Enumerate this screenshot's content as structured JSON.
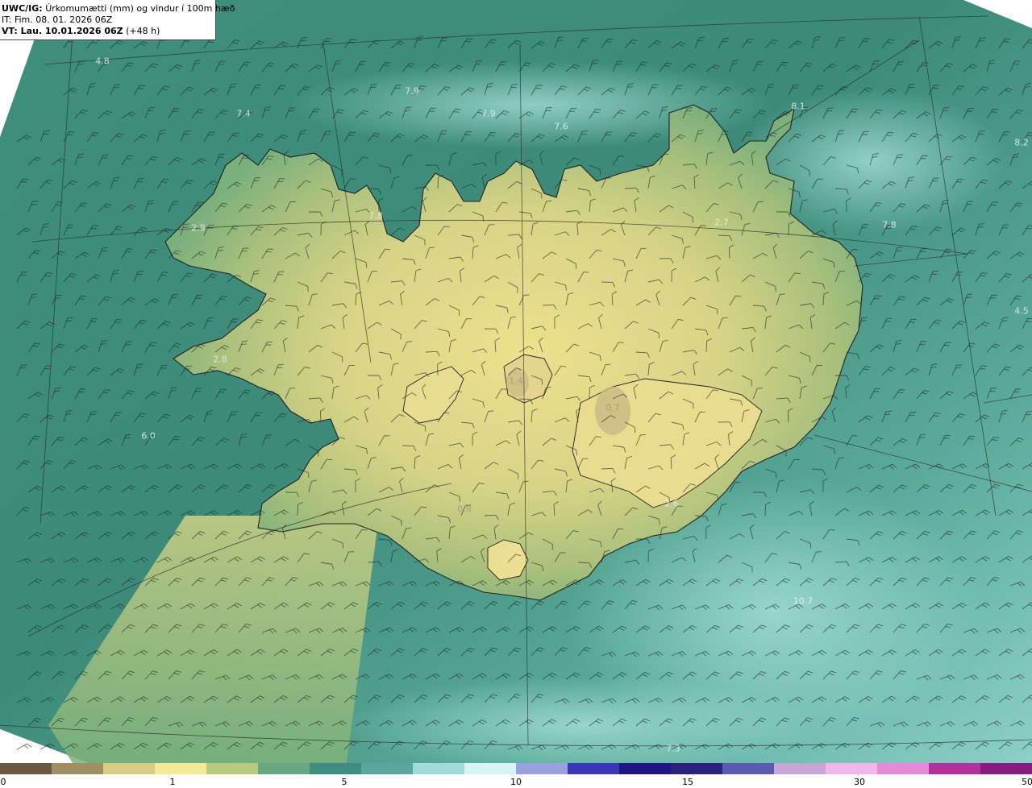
{
  "header": {
    "model": "UWC/IG:",
    "title": "Úrkomumætti (mm) og vindur í 100m hæð",
    "initial_time": "IT: Fim. 08. 01. 2026 06Z",
    "valid_prefix": "VT: Lau. 10.01.2026 06Z",
    "valid_suffix": "(+48 h)"
  },
  "value_labels": [
    {
      "text": "4.8",
      "kind": "light"
    },
    {
      "text": "7.4",
      "kind": "light"
    },
    {
      "text": "7.9",
      "kind": "light"
    },
    {
      "text": "7.9",
      "kind": "light"
    },
    {
      "text": "7.6",
      "kind": "light"
    },
    {
      "text": "8.1",
      "kind": "light"
    },
    {
      "text": "8.2",
      "kind": "light"
    },
    {
      "text": "2.9",
      "kind": "light"
    },
    {
      "text": "7.8",
      "kind": "light"
    },
    {
      "text": "2.7",
      "kind": "light"
    },
    {
      "text": "7.8",
      "kind": "light"
    },
    {
      "text": "4.5",
      "kind": "light"
    },
    {
      "text": "2.8",
      "kind": "light"
    },
    {
      "text": "6.0",
      "kind": "light"
    },
    {
      "text": "1.4",
      "kind": "dark"
    },
    {
      "text": "0.7",
      "kind": "dark"
    },
    {
      "text": "0.8",
      "kind": "dark"
    },
    {
      "text": "2.6",
      "kind": "light"
    },
    {
      "text": "10.7",
      "kind": "light"
    },
    {
      "text": "7.3",
      "kind": "light"
    }
  ],
  "colorbar": {
    "ticks": [
      "0",
      "1",
      "5",
      "10",
      "15",
      "30",
      "50"
    ],
    "colors": [
      "#6b5640",
      "#a18e62",
      "#d8cd86",
      "#f2ea95",
      "#b9c97d",
      "#6aa884",
      "#3f8c80",
      "#58a79c",
      "#9fdcd8",
      "#d8f5f5",
      "#9aa0e0",
      "#3b36b8",
      "#1c1784",
      "#2d2080",
      "#5a5ab0",
      "#c9a4d6",
      "#f4b6e8",
      "#e58ad6",
      "#b5309a",
      "#8a1a7e"
    ]
  }
}
